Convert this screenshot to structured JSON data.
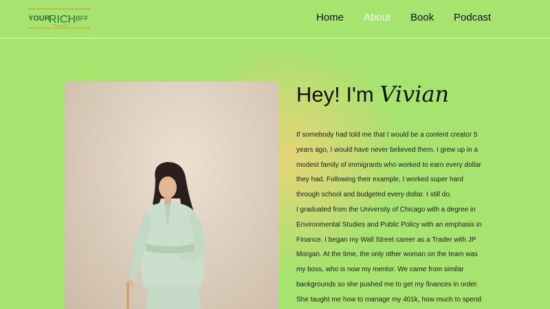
{
  "logo": {
    "part1": "YOUR",
    "part2": "RICH",
    "part3": "BFF",
    "colors": {
      "dark": "#2e6b3a",
      "gold": "#c9a23a"
    }
  },
  "nav": {
    "items": [
      {
        "label": "Home",
        "active": false
      },
      {
        "label": "About",
        "active": true
      },
      {
        "label": "Book",
        "active": false
      },
      {
        "label": "Podcast",
        "active": false
      }
    ]
  },
  "about": {
    "heading_prefix": "Hey! I'm",
    "heading_name": "Vivian",
    "paragraphs": [
      "If somebody had told me that I would be a content creator 5 years ago, I would have never believed them. I grew up in a modest family of immigrants who worked to earn every dollar they had. Following their example, I worked super hard through school and budgeted every dollar. I still do.",
      "I graduated from the University of Chicago with a degree in Environmental Studies and Public Policy with an emphasis in Finance. I began my Wall Street career as a Trader with JP Morgan. At the time, the only other woman on the team was my boss, who is now my mentor. We came from similar backgrounds so she pushed me to get my finances in order. She taught me how to manage my 401k, how much to spend"
    ]
  },
  "colors": {
    "background": "#a6e36f",
    "nav_active": "#ffffff",
    "text": "#111111",
    "glow": "#e8d478"
  }
}
